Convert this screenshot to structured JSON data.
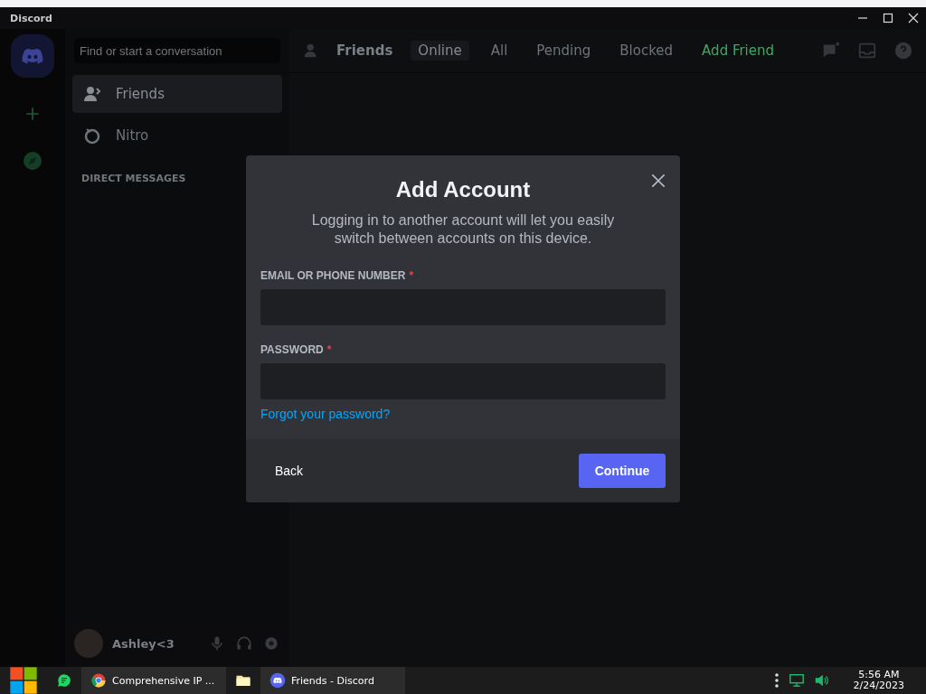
{
  "window": {
    "title": "Discord"
  },
  "app": {
    "search": {
      "placeholder": "Find or start a conversation"
    },
    "header": {
      "title": "Friends",
      "tabs": [
        {
          "label": "Online",
          "kind": "tab",
          "selected": true
        },
        {
          "label": "All",
          "kind": "tab",
          "selected": false
        },
        {
          "label": "Pending",
          "kind": "tab",
          "selected": false
        },
        {
          "label": "Blocked",
          "kind": "tab",
          "selected": false
        },
        {
          "label": "Add Friend",
          "kind": "action",
          "selected": false
        }
      ]
    },
    "sidebar": {
      "items": [
        {
          "label": "Friends",
          "selected": true
        },
        {
          "label": "Nitro",
          "selected": false
        }
      ],
      "section": "DIRECT MESSAGES"
    },
    "user": {
      "name": "Ashley<3"
    }
  },
  "modal": {
    "title": "Add Account",
    "description": "Logging in to another account will let you easily switch between accounts on this device.",
    "fields": [
      {
        "label": "EMAIL OR PHONE NUMBER",
        "required_mark": "*"
      },
      {
        "label": "PASSWORD",
        "required_mark": "*"
      }
    ],
    "link": "Forgot your password?",
    "buttons": [
      {
        "label": "Back",
        "kind": "secondary"
      },
      {
        "label": "Continue",
        "kind": "primary"
      }
    ]
  },
  "taskbar": {
    "tasks": [
      {
        "kind": "pinned"
      },
      {
        "kind": "window",
        "label": "Comprehensive IP ..."
      },
      {
        "kind": "pinned"
      },
      {
        "kind": "window",
        "label": "Friends - Discord"
      }
    ],
    "time": "5:56 AM",
    "date": "2/24/2023"
  }
}
